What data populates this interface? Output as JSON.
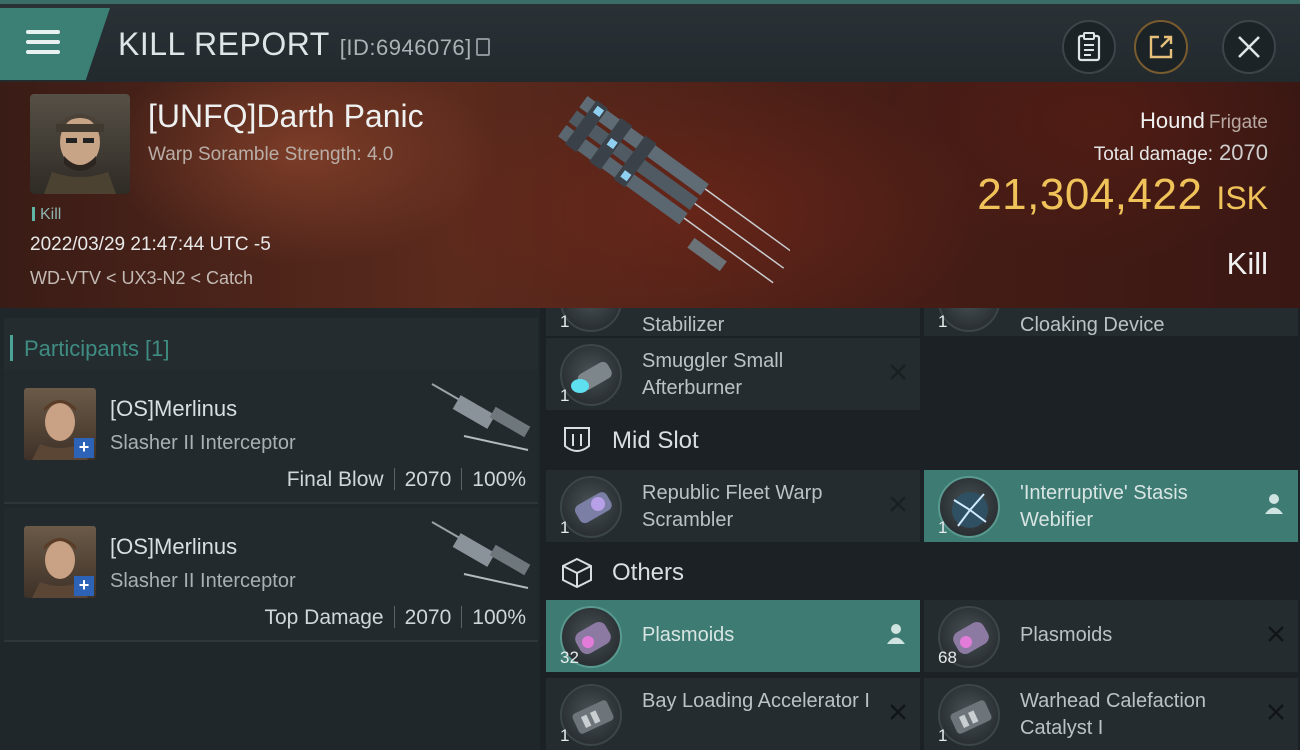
{
  "header": {
    "title": "KILL REPORT",
    "report_id": "[ID:6946076]",
    "icons": [
      "menu-icon",
      "copy-icon",
      "clipboard-icon",
      "share-icon",
      "close-icon"
    ]
  },
  "victim": {
    "name": "[UNFQ]Darth Panic",
    "subtitle": "Warp Soramble Strength: 4.0",
    "tag": "Kill",
    "datetime": "2022/03/29 21:47:44 UTC -5",
    "location": "WD-VTV < UX3-N2 < Catch",
    "ship": "Hound",
    "ship_class": "Frigate",
    "damage_label": "Total damage:",
    "damage_value": "2070",
    "isk_value": "21,304,422",
    "isk_unit": "ISK",
    "result": "Kill"
  },
  "participants": {
    "title": "Participants [1]",
    "items": [
      {
        "name": "[OS]Merlinus",
        "ship": "Slasher II Interceptor",
        "role": "Final Blow",
        "damage": "2070",
        "percent": "100%"
      },
      {
        "name": "[OS]Merlinus",
        "ship": "Slasher II Interceptor",
        "role": "Top Damage",
        "damage": "2070",
        "percent": "100%"
      }
    ]
  },
  "fitting": {
    "partial_top": [
      {
        "label": "Stabilizer",
        "qty": "1"
      },
      {
        "label": "Cloaking Device",
        "qty": "1"
      }
    ],
    "low_items": [
      {
        "label": "Smuggler Small Afterburner",
        "qty": "1",
        "state": "destroyed",
        "icon": "afterburner-icon"
      }
    ],
    "mid_slot": {
      "title": "Mid Slot",
      "icon": "mid-slot-icon",
      "items": [
        {
          "label": "Republic Fleet Warp Scrambler",
          "qty": "1",
          "state": "destroyed",
          "icon": "warp-scrambler-icon"
        },
        {
          "label": "'Interruptive' Stasis Webifier",
          "qty": "1",
          "state": "dropped",
          "icon": "stasis-webifier-icon"
        }
      ]
    },
    "others": {
      "title": "Others",
      "icon": "cargo-icon",
      "items": [
        {
          "label": "Plasmoids",
          "qty": "32",
          "state": "dropped",
          "icon": "plasmoids-icon"
        },
        {
          "label": "Plasmoids",
          "qty": "68",
          "state": "destroyed",
          "icon": "plasmoids-icon"
        },
        {
          "label": "Bay Loading Accelerator I",
          "qty": "1",
          "state": "destroyed",
          "icon": "module-icon"
        },
        {
          "label": "Warhead Calefaction Catalyst I",
          "qty": "1",
          "state": "destroyed",
          "icon": "module-icon"
        }
      ]
    }
  },
  "colors": {
    "accent_teal": "#3d7b73",
    "isk_gold": "#f0c25a",
    "participants_title": "#3f8d82"
  }
}
